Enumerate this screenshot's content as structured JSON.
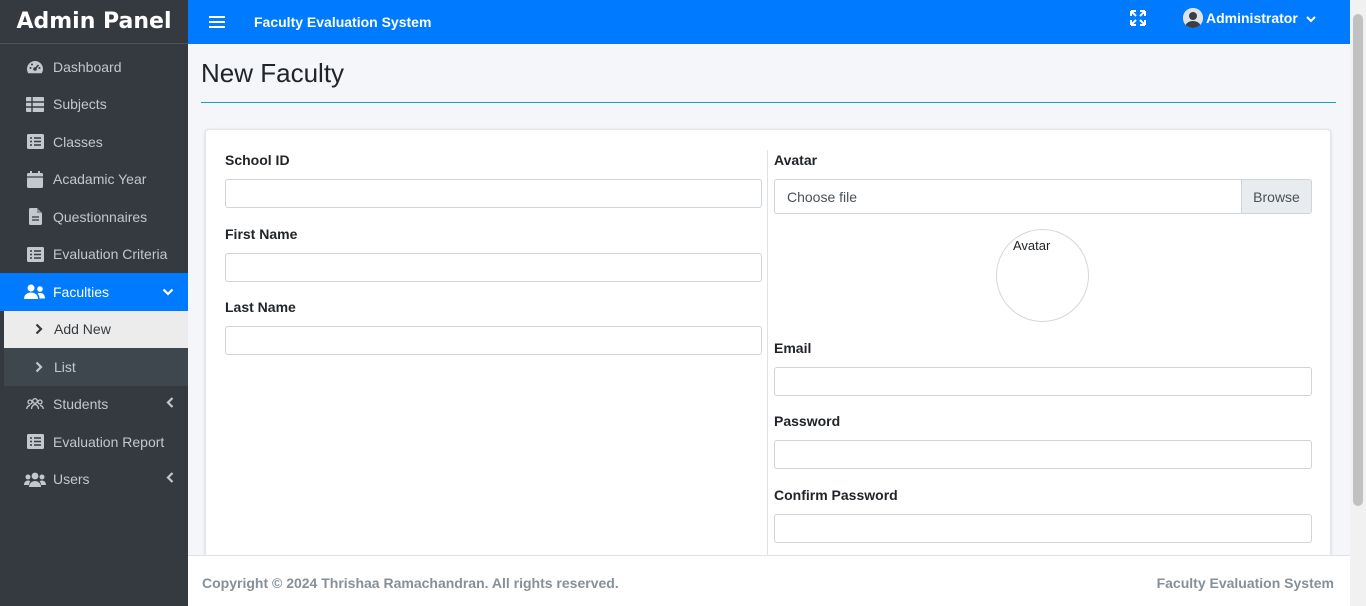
{
  "sidebar": {
    "brand": "Admin Panel",
    "items": [
      {
        "label": "Dashboard",
        "icon": "dashboard-icon"
      },
      {
        "label": "Subjects",
        "icon": "table-icon"
      },
      {
        "label": "Classes",
        "icon": "list-icon"
      },
      {
        "label": "Acadamic Year",
        "icon": "calendar-icon"
      },
      {
        "label": "Questionnaires",
        "icon": "file-icon"
      },
      {
        "label": "Evaluation Criteria",
        "icon": "list-icon"
      },
      {
        "label": "Faculties",
        "icon": "users-icon"
      },
      {
        "label": "Add New",
        "icon": "chevron-right-icon"
      },
      {
        "label": "List",
        "icon": "chevron-right-icon"
      },
      {
        "label": "Students",
        "icon": "students-icon"
      },
      {
        "label": "Evaluation Report",
        "icon": "list-icon"
      },
      {
        "label": "Users",
        "icon": "users-icon"
      }
    ]
  },
  "header": {
    "title": "Faculty Evaluation System",
    "user": "Administrator",
    "accent": "#007bff"
  },
  "main": {
    "page_title": "New Faculty",
    "form": {
      "school_id_label": "School ID",
      "first_name_label": "First Name",
      "last_name_label": "Last Name",
      "avatar_label": "Avatar",
      "file_placeholder": "Choose file",
      "browse_label": "Browse",
      "avatar_alt": "Avatar",
      "email_label": "Email",
      "password_label": "Password",
      "confirm_password_label": "Confirm Password"
    }
  },
  "footer": {
    "copyright": "Copyright © 2024 Thrishaa Ramachandran. All rights reserved.",
    "app_name": "Faculty Evaluation System"
  }
}
